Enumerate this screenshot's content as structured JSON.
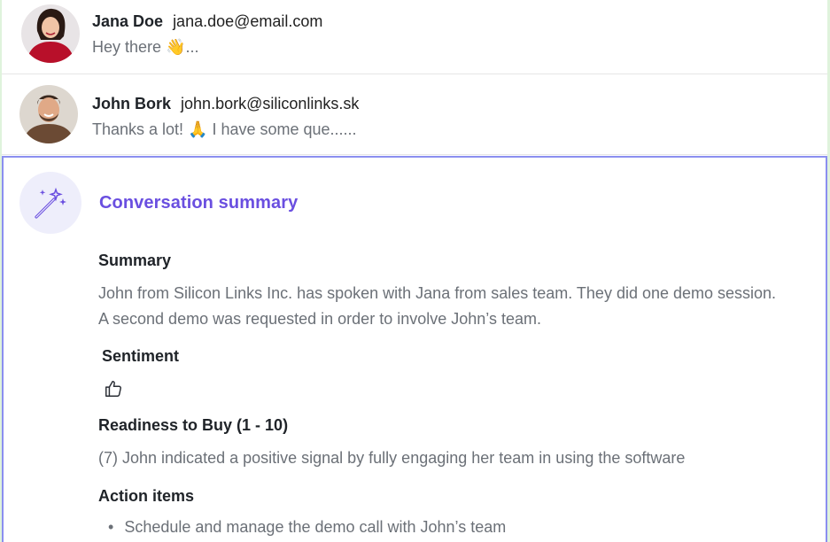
{
  "conversations": [
    {
      "name": "Jana Doe",
      "email": "jana.doe@email.com",
      "preview": "Hey there 👋..."
    },
    {
      "name": "John Bork",
      "email": "john.bork@siliconlinks.sk",
      "preview": "Thanks a lot! 🙏 I have some que......"
    }
  ],
  "summary_panel": {
    "title": "Conversation summary",
    "icon": "magic-wand-icon",
    "summary_heading": "Summary",
    "summary_text": "John from Silicon Links Inc. has spoken with Jana from sales team. They did one demo session. A second demo was requested in order to involve John’s team.",
    "sentiment_heading": "Sentiment",
    "sentiment_icon": "thumbs-up-icon",
    "readiness_heading": "Readiness to Buy (1 - 10)",
    "readiness_text": "(7) John indicated a positive signal by fully engaging her team in using the software",
    "actions_heading": "Action items",
    "action_items": [
      "Schedule and manage the demo call with John’s team"
    ]
  },
  "colors": {
    "accent": "#6a4fe0",
    "panel_border": "#8b8ff0",
    "icon_bg": "#eeeefb",
    "muted_text": "#6b7077"
  }
}
